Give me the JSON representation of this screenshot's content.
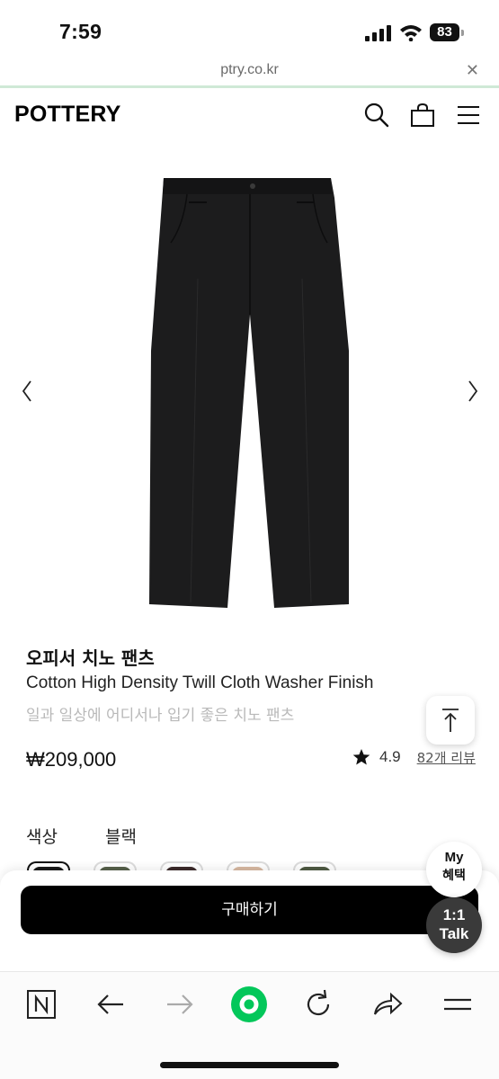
{
  "status_bar": {
    "time": "7:59",
    "battery": "83"
  },
  "url_bar": {
    "url": "ptry.co.kr",
    "close_label": "✕"
  },
  "header": {
    "logo": "POTTERY"
  },
  "product": {
    "name_ko": "오피서 치노 팬츠",
    "name_en": "Cotton High Density Twill Cloth Washer Finish",
    "description": "일과 일상에 어디서나 입기 좋은 치노 팬츠",
    "price": "₩209,000",
    "rating": "4.9",
    "review_link": "82개 리뷰"
  },
  "options": {
    "color_label": "색상",
    "color_value": "블랙",
    "swatch_colors": [
      "#1a1a1a",
      "#56604a",
      "#3b2a2a",
      "#d8b9a2",
      "#4f5a43"
    ]
  },
  "buy_sheet": {
    "buy_label": "구매하기"
  },
  "floating": {
    "benefit_line1": "My",
    "benefit_line2": "혜택",
    "talk_line1": "1:1",
    "talk_line2": "Talk"
  },
  "colors": {
    "accent_green": "#03c75a",
    "url_underline": "#cfe9d6",
    "muted_text": "#b9b9b9"
  }
}
